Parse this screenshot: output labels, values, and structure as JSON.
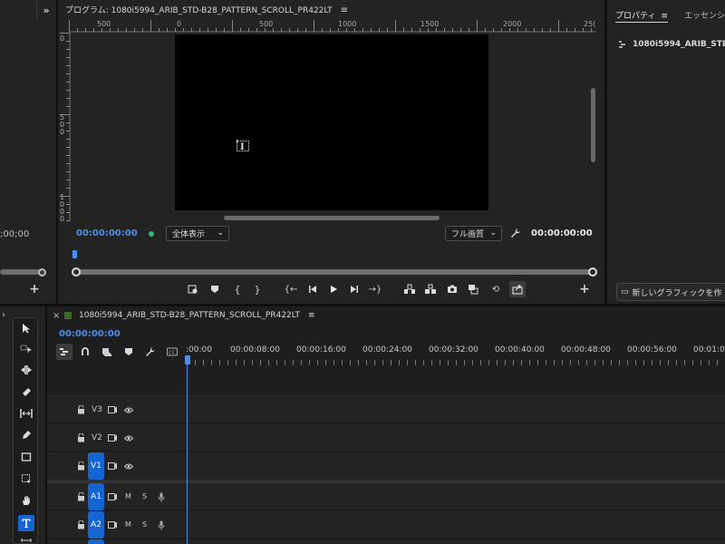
{
  "left_panel": {
    "timecode": ";00;00",
    "add_label": "+"
  },
  "program_monitor": {
    "title": "プログラム: 1080i5994_ARIB_STD-B28_PATTERN_SCROLL_PR422LT",
    "menu_icon": "hamburger-icon",
    "ruler_top_labels": [
      "500",
      "0",
      "500",
      "1000",
      "1500",
      "2000",
      "25("
    ],
    "ruler_left_labels": [
      "0",
      "5\n0\n0",
      "1\n0\n0\n0"
    ],
    "timecode_left": "00:00:00:00",
    "zoom_select": "全体表示",
    "quality_select": "フル画質",
    "timecode_right": "00:00:00:00",
    "add_label": "+"
  },
  "properties_panel": {
    "tab_properties": "プロパティ",
    "tab_essential": "エッセンシ",
    "sequence_name": "1080i5994_ARIB_STD",
    "new_graphic_button": "新しいグラフィックを作"
  },
  "timeline": {
    "close_label": "×",
    "sequence_tab": "1080i5994_ARIB_STD-B28_PATTERN_SCROLL_PR422LT",
    "timecode": "00:00:00:00",
    "ruler_labels": [
      ":00:00",
      "00:00:08:00",
      "00:00:16:00",
      "00:00:24:00",
      "00:00:32:00",
      "00:00:40:00",
      "00:00:48:00",
      "00:00:56:00",
      "00:01:04"
    ],
    "video_tracks": [
      {
        "name": "V3",
        "target": false
      },
      {
        "name": "V2",
        "target": false
      },
      {
        "name": "V1",
        "target": true
      }
    ],
    "audio_tracks": [
      {
        "name": "A1",
        "mute": "M",
        "solo": "S"
      },
      {
        "name": "A2",
        "mute": "M",
        "solo": "S"
      }
    ]
  },
  "tools": [
    "selection-tool",
    "track-select-tool",
    "ripple-edit-tool",
    "razor-tool",
    "slip-tool",
    "pen-tool",
    "rectangle-tool",
    "hand-tool",
    "type-tool"
  ],
  "colors": {
    "accent_blue": "#1464d2",
    "timecode_blue": "#4f8fe8",
    "panel_bg": "#232323",
    "app_bg": "#0f0f0f",
    "video_black": "#000000"
  }
}
